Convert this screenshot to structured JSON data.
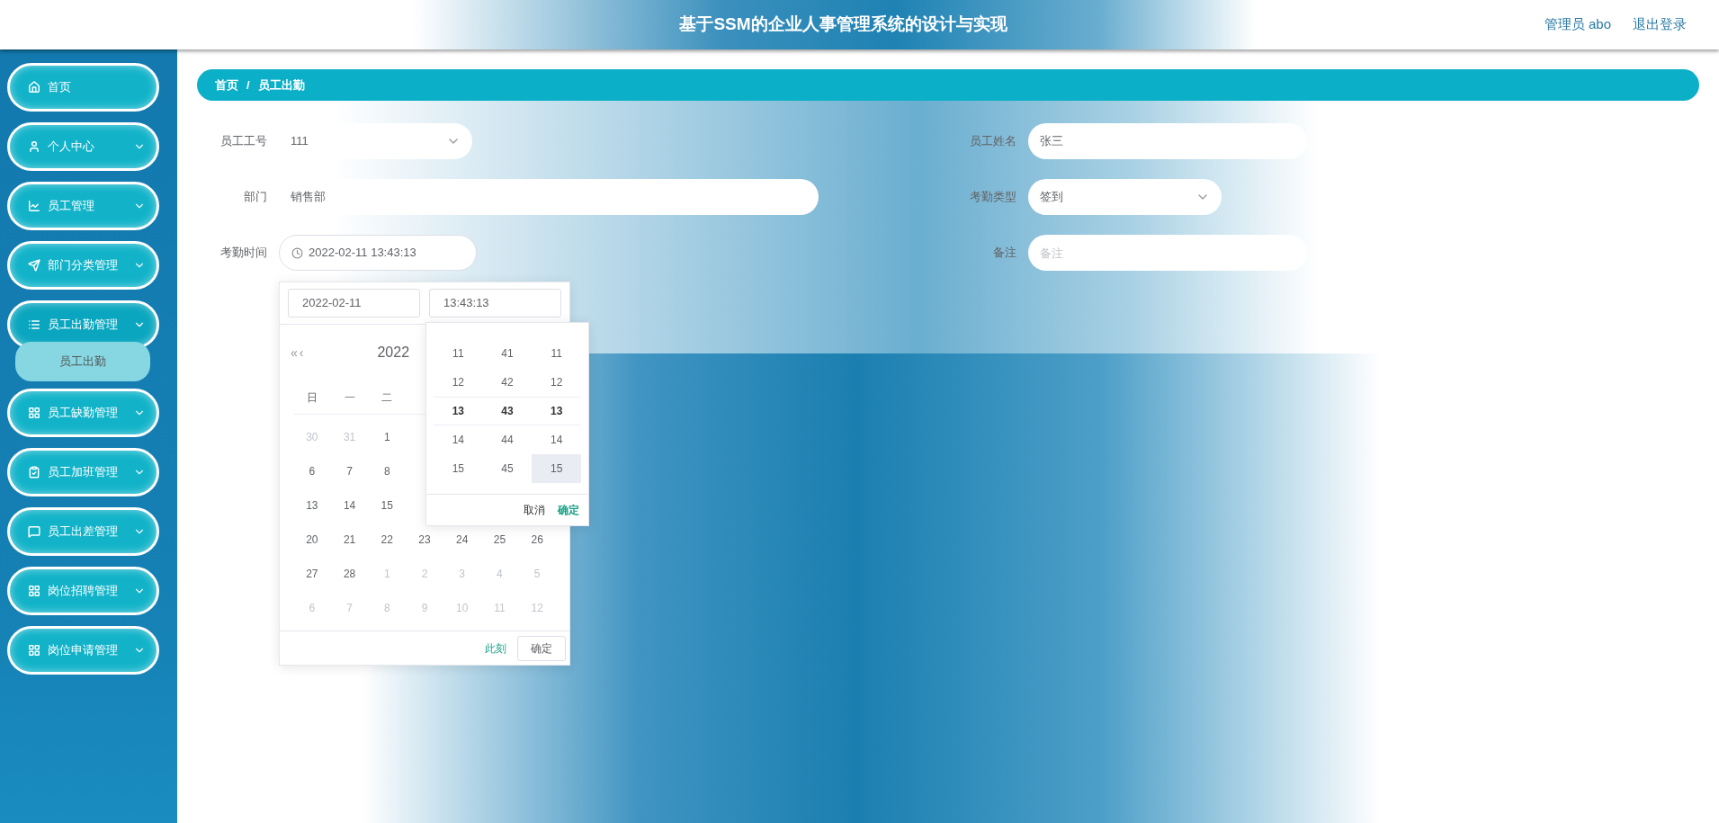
{
  "header": {
    "title": "基于SSM的企业人事管理系统的设计与实现",
    "user": "管理员 abo",
    "logout": "退出登录"
  },
  "sidebar": {
    "items": [
      {
        "label": "首页",
        "kind": "link",
        "expanded": false
      },
      {
        "label": "个人中心",
        "kind": "submenu",
        "expanded": false
      },
      {
        "label": "员工管理",
        "kind": "submenu",
        "expanded": false
      },
      {
        "label": "部门分类管理",
        "kind": "submenu",
        "expanded": false
      },
      {
        "label": "员工出勤管理",
        "kind": "submenu",
        "expanded": true,
        "children": [
          {
            "label": "员工出勤",
            "selected": true
          }
        ]
      },
      {
        "label": "员工缺勤管理",
        "kind": "submenu",
        "expanded": false
      },
      {
        "label": "员工加班管理",
        "kind": "submenu",
        "expanded": false
      },
      {
        "label": "员工出差管理",
        "kind": "submenu",
        "expanded": false
      },
      {
        "label": "岗位招聘管理",
        "kind": "submenu",
        "expanded": false
      },
      {
        "label": "岗位申请管理",
        "kind": "submenu",
        "expanded": false
      }
    ]
  },
  "breadcrumb": [
    "首页",
    "员工出勤"
  ],
  "breadcrumb_separator": "/",
  "form": {
    "left": [
      {
        "label": "员工工号",
        "kind": "select",
        "value": "111"
      },
      {
        "label": "部门",
        "kind": "text",
        "value": "销售部"
      },
      {
        "label": "考勤时间",
        "kind": "datetime",
        "value": "2022-02-11 13:43:13"
      }
    ],
    "right": [
      {
        "label": "员工姓名",
        "kind": "text",
        "value": "张三"
      },
      {
        "label": "考勤类型",
        "kind": "select",
        "value": "签到"
      },
      {
        "label": "备注",
        "kind": "text",
        "placeholder": "备注"
      }
    ]
  },
  "date_picker": {
    "date_input": "2022-02-11",
    "time_input": "13:43:13",
    "year": "2022",
    "prev_year": "«",
    "prev_month": "‹",
    "weekdays": [
      "日",
      "一",
      "二"
    ],
    "weeks": [
      [
        {
          "day": "30",
          "other_month": true
        },
        {
          "day": "31",
          "other_month": true
        },
        {
          "day": "1",
          "other_month": false
        }
      ],
      [
        {
          "day": "6",
          "other_month": false
        },
        {
          "day": "7",
          "other_month": false
        },
        {
          "day": "8",
          "other_month": false
        }
      ],
      [
        {
          "day": "13",
          "other_month": false
        },
        {
          "day": "14",
          "other_month": false
        },
        {
          "day": "15",
          "other_month": false
        }
      ],
      [
        {
          "day": "20",
          "other_month": false
        },
        {
          "day": "21",
          "other_month": false
        },
        {
          "day": "22",
          "other_month": false
        },
        {
          "day": "23",
          "other_month": false
        },
        {
          "day": "24",
          "other_month": false
        },
        {
          "day": "25",
          "other_month": false
        },
        {
          "day": "26",
          "other_month": false
        }
      ],
      [
        {
          "day": "27",
          "other_month": false
        },
        {
          "day": "28",
          "other_month": false
        },
        {
          "day": "1",
          "other_month": true
        },
        {
          "day": "2",
          "other_month": true
        },
        {
          "day": "3",
          "other_month": true
        },
        {
          "day": "4",
          "other_month": true
        },
        {
          "day": "5",
          "other_month": true
        }
      ],
      [
        {
          "day": "6",
          "other_month": true
        },
        {
          "day": "7",
          "other_month": true
        },
        {
          "day": "8",
          "other_month": true
        },
        {
          "day": "9",
          "other_month": true
        },
        {
          "day": "10",
          "other_month": true
        },
        {
          "day": "11",
          "other_month": true
        },
        {
          "day": "12",
          "other_month": true
        }
      ]
    ],
    "now_link": "此刻",
    "ok_button": "确定",
    "time_panel": {
      "columns": [
        [
          {
            "value": "11",
            "selected": false,
            "hovered": false
          },
          {
            "value": "12",
            "selected": false,
            "hovered": false
          },
          {
            "value": "13",
            "selected": true,
            "hovered": false
          },
          {
            "value": "14",
            "selected": false,
            "hovered": false
          },
          {
            "value": "15",
            "selected": false,
            "hovered": false
          }
        ],
        [
          {
            "value": "41",
            "selected": false,
            "hovered": false
          },
          {
            "value": "42",
            "selected": false,
            "hovered": false
          },
          {
            "value": "43",
            "selected": true,
            "hovered": false
          },
          {
            "value": "44",
            "selected": false,
            "hovered": false
          },
          {
            "value": "45",
            "selected": false,
            "hovered": false
          }
        ],
        [
          {
            "value": "11",
            "selected": false,
            "hovered": false
          },
          {
            "value": "12",
            "selected": false,
            "hovered": false
          },
          {
            "value": "13",
            "selected": true,
            "hovered": false
          },
          {
            "value": "14",
            "selected": false,
            "hovered": false
          },
          {
            "value": "15",
            "selected": false,
            "hovered": true
          }
        ]
      ],
      "cancel": "取消",
      "confirm": "确定"
    }
  }
}
